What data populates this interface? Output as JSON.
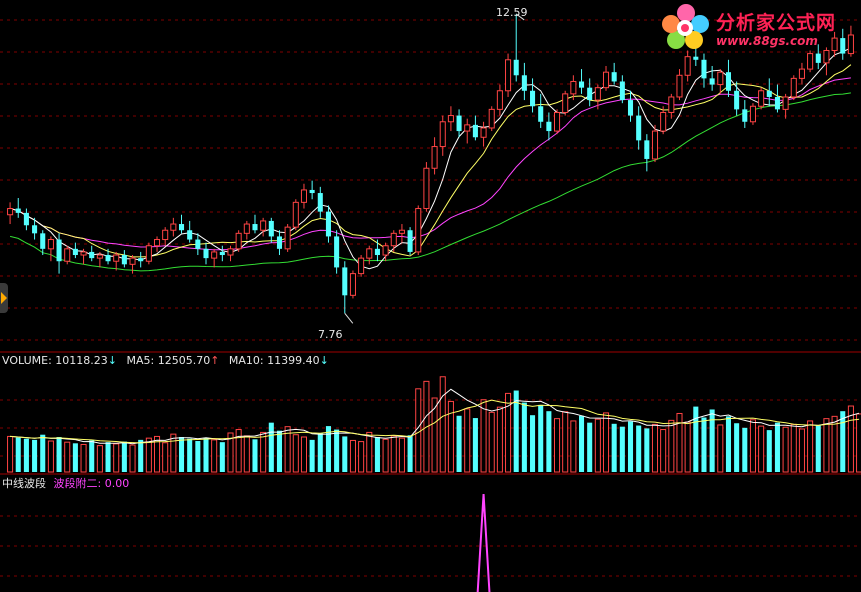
{
  "price_panel": {
    "high_label": "12.59",
    "low_label": "7.76"
  },
  "volume_panel": {
    "volume_label": "VOLUME: 10118.23",
    "ma5_label": "MA5: 12505.70",
    "ma10_label": "MA10: 11399.40"
  },
  "indicator_panel": {
    "name": "中线波段",
    "series_label": "波段附二: 0.00"
  },
  "watermark": {
    "title": "分析家公式网",
    "url": "www.88gs.com"
  },
  "colors": {
    "up": "#ff4444",
    "down": "#55ffff",
    "grid": "#800000",
    "ma_fast": "#ffffff",
    "ma_mid": "#ffff66",
    "ma_slow": "#ff44ff",
    "ma_long": "#33dd33",
    "indicator": "#ff44ff"
  },
  "chart_data": [
    {
      "type": "candlestick",
      "series": [
        {
          "name": "OHLC",
          "values": []
        }
      ],
      "high": 12.59,
      "low": 7.76,
      "ohlc": [
        [
          9.35,
          9.55,
          9.2,
          9.45
        ],
        [
          9.45,
          9.62,
          9.3,
          9.38
        ],
        [
          9.38,
          9.45,
          9.1,
          9.18
        ],
        [
          9.18,
          9.3,
          8.95,
          9.05
        ],
        [
          9.05,
          9.1,
          8.7,
          8.8
        ],
        [
          8.8,
          9.0,
          8.6,
          8.95
        ],
        [
          8.95,
          9.05,
          8.4,
          8.6
        ],
        [
          8.6,
          8.85,
          8.55,
          8.8
        ],
        [
          8.8,
          8.9,
          8.65,
          8.7
        ],
        [
          8.7,
          8.8,
          8.55,
          8.75
        ],
        [
          8.75,
          8.85,
          8.6,
          8.65
        ],
        [
          8.65,
          8.75,
          8.5,
          8.7
        ],
        [
          8.7,
          8.8,
          8.55,
          8.6
        ],
        [
          8.6,
          8.75,
          8.45,
          8.7
        ],
        [
          8.7,
          8.78,
          8.5,
          8.55
        ],
        [
          8.55,
          8.7,
          8.4,
          8.65
        ],
        [
          8.65,
          8.75,
          8.5,
          8.6
        ],
        [
          8.6,
          8.9,
          8.55,
          8.85
        ],
        [
          8.85,
          9.0,
          8.75,
          8.95
        ],
        [
          8.95,
          9.15,
          8.85,
          9.1
        ],
        [
          9.1,
          9.3,
          9.0,
          9.2
        ],
        [
          9.2,
          9.35,
          9.05,
          9.1
        ],
        [
          9.1,
          9.25,
          8.9,
          8.95
        ],
        [
          8.95,
          9.05,
          8.7,
          8.8
        ],
        [
          8.8,
          8.9,
          8.55,
          8.65
        ],
        [
          8.65,
          8.8,
          8.5,
          8.75
        ],
        [
          8.75,
          8.85,
          8.6,
          8.7
        ],
        [
          8.7,
          8.85,
          8.6,
          8.8
        ],
        [
          8.8,
          9.1,
          8.75,
          9.05
        ],
        [
          9.05,
          9.25,
          8.95,
          9.2
        ],
        [
          9.2,
          9.35,
          9.05,
          9.1
        ],
        [
          9.1,
          9.3,
          9.0,
          9.25
        ],
        [
          9.25,
          9.3,
          8.9,
          9.0
        ],
        [
          9.0,
          9.1,
          8.7,
          8.8
        ],
        [
          8.8,
          9.2,
          8.75,
          9.15
        ],
        [
          9.15,
          9.6,
          9.1,
          9.55
        ],
        [
          9.55,
          9.85,
          9.45,
          9.75
        ],
        [
          9.75,
          9.9,
          9.6,
          9.7
        ],
        [
          9.7,
          9.8,
          9.3,
          9.4
        ],
        [
          9.4,
          9.5,
          8.9,
          9.0
        ],
        [
          9.0,
          9.1,
          8.4,
          8.5
        ],
        [
          8.5,
          8.6,
          7.76,
          8.05
        ],
        [
          8.05,
          8.45,
          8.0,
          8.4
        ],
        [
          8.4,
          8.7,
          8.35,
          8.65
        ],
        [
          8.65,
          8.85,
          8.55,
          8.8
        ],
        [
          8.8,
          8.95,
          8.6,
          8.7
        ],
        [
          8.7,
          8.9,
          8.6,
          8.85
        ],
        [
          8.85,
          9.1,
          8.75,
          9.05
        ],
        [
          9.05,
          9.2,
          8.9,
          9.1
        ],
        [
          9.1,
          9.15,
          8.7,
          8.75
        ],
        [
          8.75,
          9.5,
          8.7,
          9.45
        ],
        [
          9.45,
          10.2,
          9.4,
          10.1
        ],
        [
          10.1,
          10.6,
          10.0,
          10.45
        ],
        [
          10.45,
          10.95,
          10.3,
          10.85
        ],
        [
          10.85,
          11.1,
          10.7,
          10.95
        ],
        [
          10.95,
          11.05,
          10.6,
          10.7
        ],
        [
          10.7,
          10.9,
          10.5,
          10.8
        ],
        [
          10.8,
          10.95,
          10.55,
          10.6
        ],
        [
          10.6,
          10.85,
          10.45,
          10.75
        ],
        [
          10.75,
          11.1,
          10.7,
          11.05
        ],
        [
          11.05,
          11.45,
          10.95,
          11.35
        ],
        [
          11.35,
          11.95,
          11.25,
          11.85
        ],
        [
          11.85,
          12.59,
          11.5,
          11.6
        ],
        [
          11.6,
          11.8,
          11.2,
          11.35
        ],
        [
          11.35,
          11.55,
          11.0,
          11.1
        ],
        [
          11.1,
          11.3,
          10.75,
          10.85
        ],
        [
          10.85,
          11.0,
          10.55,
          10.7
        ],
        [
          10.7,
          11.05,
          10.65,
          11.0
        ],
        [
          11.0,
          11.35,
          10.95,
          11.3
        ],
        [
          11.3,
          11.6,
          11.2,
          11.5
        ],
        [
          11.5,
          11.7,
          11.3,
          11.4
        ],
        [
          11.4,
          11.55,
          11.1,
          11.2
        ],
        [
          11.2,
          11.45,
          11.05,
          11.4
        ],
        [
          11.4,
          11.75,
          11.35,
          11.65
        ],
        [
          11.65,
          11.8,
          11.45,
          11.5
        ],
        [
          11.5,
          11.6,
          11.15,
          11.2
        ],
        [
          11.2,
          11.35,
          10.85,
          10.95
        ],
        [
          10.95,
          11.1,
          10.4,
          10.55
        ],
        [
          10.55,
          10.65,
          10.05,
          10.25
        ],
        [
          10.25,
          10.8,
          10.2,
          10.7
        ],
        [
          10.7,
          11.1,
          10.65,
          11.0
        ],
        [
          11.0,
          11.3,
          10.9,
          11.25
        ],
        [
          11.25,
          11.7,
          11.2,
          11.6
        ],
        [
          11.6,
          12.0,
          11.5,
          11.9
        ],
        [
          11.9,
          12.2,
          11.75,
          11.85
        ],
        [
          11.85,
          11.95,
          11.4,
          11.55
        ],
        [
          11.55,
          11.75,
          11.35,
          11.45
        ],
        [
          11.45,
          11.7,
          11.3,
          11.65
        ],
        [
          11.65,
          11.85,
          11.25,
          11.35
        ],
        [
          11.35,
          11.5,
          10.95,
          11.05
        ],
        [
          11.05,
          11.2,
          10.75,
          10.85
        ],
        [
          10.85,
          11.15,
          10.8,
          11.1
        ],
        [
          11.1,
          11.4,
          11.05,
          11.35
        ],
        [
          11.35,
          11.55,
          11.1,
          11.25
        ],
        [
          11.25,
          11.45,
          11.0,
          11.05
        ],
        [
          11.05,
          11.3,
          10.9,
          11.25
        ],
        [
          11.25,
          11.6,
          11.2,
          11.55
        ],
        [
          11.55,
          11.8,
          11.45,
          11.7
        ],
        [
          11.7,
          12.0,
          11.65,
          11.95
        ],
        [
          11.95,
          12.1,
          11.7,
          11.8
        ],
        [
          11.8,
          12.05,
          11.6,
          12.0
        ],
        [
          12.0,
          12.3,
          11.9,
          12.2
        ],
        [
          12.2,
          12.35,
          11.85,
          11.95
        ],
        [
          11.95,
          12.4,
          11.9,
          12.25
        ]
      ],
      "ma_periods": [
        5,
        10,
        20,
        60
      ]
    },
    {
      "type": "bar",
      "series": [
        {
          "name": "VOLUME",
          "values": [
            6200,
            6000,
            5800,
            5600,
            6500,
            5400,
            6100,
            5200,
            5000,
            4800,
            5500,
            4600,
            5200,
            4900,
            5300,
            4700,
            5600,
            5900,
            6200,
            5100,
            6600,
            6100,
            5800,
            5400,
            6000,
            5600,
            5200,
            6800,
            7400,
            6300,
            5700,
            6900,
            8600,
            7200,
            7900,
            6500,
            6100,
            5600,
            6800,
            8000,
            7400,
            6200,
            5500,
            5300,
            6900,
            6100,
            5700,
            6300,
            5900,
            6400,
            14500,
            15800,
            12900,
            16600,
            12300,
            9800,
            11000,
            9400,
            12600,
            10400,
            11300,
            13700,
            14200,
            12100,
            9900,
            11700,
            10600,
            9300,
            10500,
            8900,
            9800,
            8600,
            9200,
            10300,
            8400,
            7900,
            8800,
            8100,
            7600,
            8300,
            7400,
            9000,
            10200,
            8700,
            11400,
            9500,
            10900,
            8200,
            9700,
            8500,
            7700,
            9100,
            8000,
            7300,
            8600,
            7800,
            8300,
            7500,
            8900,
            8100,
            9300,
            9700,
            10600,
            11500,
            10118
          ]
        }
      ],
      "ma5_label_value": 12505.7,
      "ma10_label_value": 11399.4
    },
    {
      "type": "line",
      "series": [
        {
          "name": "波段附二",
          "spike_index": 58,
          "spike_value": 1.0,
          "base_value": 0.0
        }
      ]
    }
  ]
}
